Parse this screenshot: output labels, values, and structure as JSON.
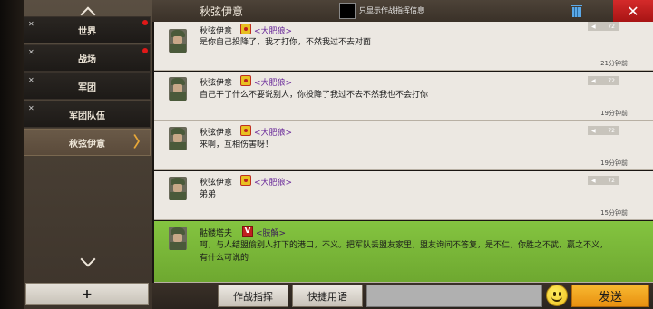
{
  "header": {
    "chat_title": "秋弦伊意",
    "command_only_label": "只显示作战指挥信息",
    "close_label": "✕"
  },
  "sidebar": {
    "channels": [
      {
        "label": "世界",
        "unread": true
      },
      {
        "label": "战场",
        "unread": true
      },
      {
        "label": "军团",
        "unread": false
      },
      {
        "label": "军团队伍",
        "unread": false
      },
      {
        "label": "秋弦伊意",
        "unread": false,
        "active": true
      }
    ],
    "active_arrow": "〉",
    "add_label": "+"
  },
  "messages": [
    {
      "sender": "秋弦伊意",
      "alliance": "<大肥狼>",
      "badge": "nuke",
      "voice": "72",
      "text": "是你自己投降了，我才打你，不然我过不去对面",
      "time": "21分钟前"
    },
    {
      "sender": "秋弦伊意",
      "alliance": "<大肥狼>",
      "badge": "nuke",
      "voice": "72",
      "text": "自己干了什么不要说别人，你投降了我过不去不然我也不会打你",
      "time": "19分钟前"
    },
    {
      "sender": "秋弦伊意",
      "alliance": "<大肥狼>",
      "badge": "nuke",
      "voice": "72",
      "text": "来啊，互相伤害呀！",
      "time": "19分钟前"
    },
    {
      "sender": "秋弦伊意",
      "alliance": "<大肥狼>",
      "badge": "nuke",
      "voice": "72",
      "text": "弟弟",
      "time": "15分钟前"
    },
    {
      "sender": "骷髅塔夫",
      "alliance": "<肢解>",
      "badge": "V",
      "voice": "",
      "text": "呵，与人结盟偷别人打下的港口，不义。把军队丢盟友家里，盟友询问不答复，是不仁，你胜之不武，赢之不义，有什么可说的",
      "time": ""
    }
  ],
  "footer": {
    "command_button": "作战指挥",
    "quick_phrase_button": "快捷用语",
    "send_button": "发送"
  },
  "colors": {
    "own_message_bg": "#ece8e2",
    "other_message_bg": "#7cbc38",
    "send_button": "#f0a020",
    "close_button": "#c01e1e",
    "alliance_text": "#6a2a9a"
  }
}
